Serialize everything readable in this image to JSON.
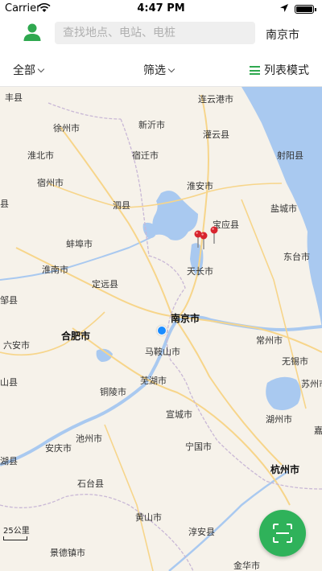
{
  "status_bar": {
    "carrier": "Carrier",
    "time": "4:47 PM"
  },
  "header": {
    "search_placeholder": "查找地点、电站、电桩",
    "city": "南京市"
  },
  "filters": {
    "all": "全部",
    "screen": "筛选",
    "list_mode": "列表模式"
  },
  "map": {
    "labels": {
      "xianxian": "丰县",
      "lianyungang": "连云港市",
      "xuzhou": "徐州市",
      "xinyi": "新沂市",
      "guanyun": "灌云县",
      "huaibei": "淮北市",
      "suqian": "宿迁市",
      "sheyang": "射阳县",
      "suzhou_ah": "宿州市",
      "huaian": "淮安市",
      "sixian": "泗县",
      "yancheng": "盐城市",
      "xian_l": "县",
      "baoying": "宝应县",
      "bengbu": "蚌埠市",
      "dongtai": "东台市",
      "huainan": "淮南市",
      "tianchang": "天长市",
      "dingyuan": "定远县",
      "zouxian": "邹县",
      "nanjing": "南京市",
      "hefei": "合肥市",
      "changzhou": "常州市",
      "lu_an": "六安市",
      "maanshan": "马鞍山市",
      "wuxi": "无锡市",
      "shanxian": "山县",
      "wuhu": "芜湖市",
      "suzhou_js": "苏州市",
      "tongling": "铜陵市",
      "xuancheng": "宣城市",
      "huzhou": "湖州市",
      "jia": "嘉",
      "chizhou": "池州市",
      "anqing": "安庆市",
      "ningguo": "宁国市",
      "huxian": "湖县",
      "shitai": "石台县",
      "hangzhou": "杭州市",
      "huangshan": "黄山市",
      "chun_an": "淳安县",
      "jingdezhen": "景德镇市",
      "jinhua": "金华市"
    },
    "scale": "25公里"
  },
  "colors": {
    "accent": "#2fb25a",
    "water": "#a9c9f0",
    "my_location": "#1a8cff",
    "pin": "#d8242e"
  },
  "icons": {
    "avatar": "user-icon",
    "scan": "scan-icon",
    "list": "list-icon",
    "pin": "map-pin-icon",
    "location": "location-arrow-icon"
  }
}
